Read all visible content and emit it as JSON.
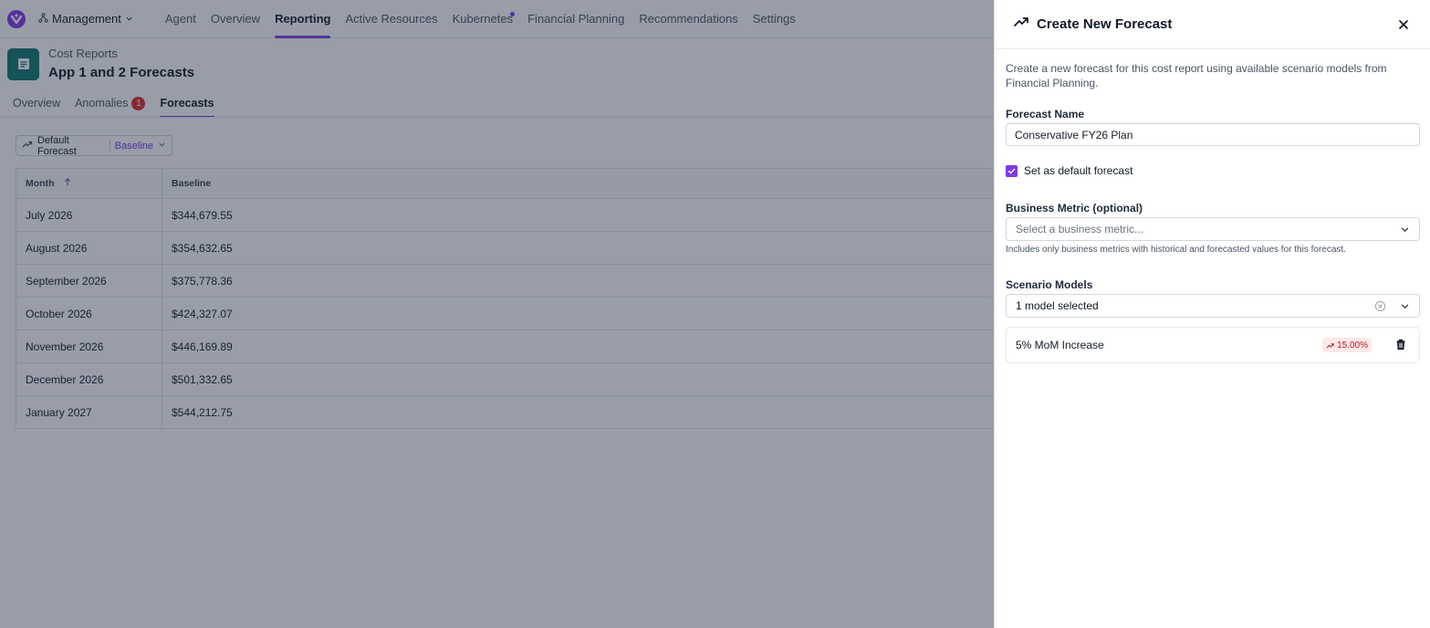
{
  "topnav": {
    "workspace": "Management",
    "tabs": [
      {
        "label": "Agent"
      },
      {
        "label": "Overview"
      },
      {
        "label": "Reporting",
        "active": true
      },
      {
        "label": "Active Resources"
      },
      {
        "label": "Kubernetes",
        "dot": true
      },
      {
        "label": "Financial Planning"
      },
      {
        "label": "Recommendations"
      },
      {
        "label": "Settings"
      }
    ]
  },
  "header": {
    "breadcrumb": "Cost Reports",
    "title": "App 1 and 2 Forecasts"
  },
  "subtabs": {
    "overview": "Overview",
    "anomalies": "Anomalies",
    "anomalies_count": "1",
    "forecasts": "Forecasts"
  },
  "forecast_selector": {
    "label": "Default Forecast",
    "scenario": "Baseline"
  },
  "table": {
    "headers": {
      "month": "Month",
      "baseline": "Baseline"
    },
    "rows": [
      {
        "month": "July 2026",
        "baseline": "$344,679.55"
      },
      {
        "month": "August 2026",
        "baseline": "$354,632.65"
      },
      {
        "month": "September 2026",
        "baseline": "$375,778.36"
      },
      {
        "month": "October 2026",
        "baseline": "$424,327.07"
      },
      {
        "month": "November 2026",
        "baseline": "$446,169.89"
      },
      {
        "month": "December 2026",
        "baseline": "$501,332.65"
      },
      {
        "month": "January 2027",
        "baseline": "$544,212.75"
      }
    ]
  },
  "drawer": {
    "title": "Create New Forecast",
    "description": "Create a new forecast for this cost report using available scenario models from Financial Planning.",
    "forecast_name_label": "Forecast Name",
    "forecast_name_value": "Conservative FY26 Plan",
    "default_checkbox_label": "Set as default forecast",
    "default_checked": true,
    "business_metric_label": "Business Metric (optional)",
    "business_metric_placeholder": "Select a business metric...",
    "business_metric_help": "Includes only business metrics with historical and forecasted values for this forecast.",
    "scenario_models_label": "Scenario Models",
    "scenario_models_value": "1 model selected",
    "models": [
      {
        "name": "5% MoM Increase",
        "change": "15.00%"
      }
    ]
  },
  "colors": {
    "accent": "#7c3aed",
    "report_icon": "#0f766e",
    "badge": "#dc2626",
    "trend_text": "#b91c1c",
    "trend_bg": "#fde8e8"
  },
  "icons": {
    "logo": "brand-logo-icon",
    "workspace": "org-tree-icon",
    "report": "document-icon",
    "forecast": "trend-up-icon",
    "close": "close-icon",
    "chevron": "chevron-down-icon",
    "clear": "clear-circle-icon",
    "delete": "trash-icon",
    "sort": "arrow-up-icon"
  }
}
